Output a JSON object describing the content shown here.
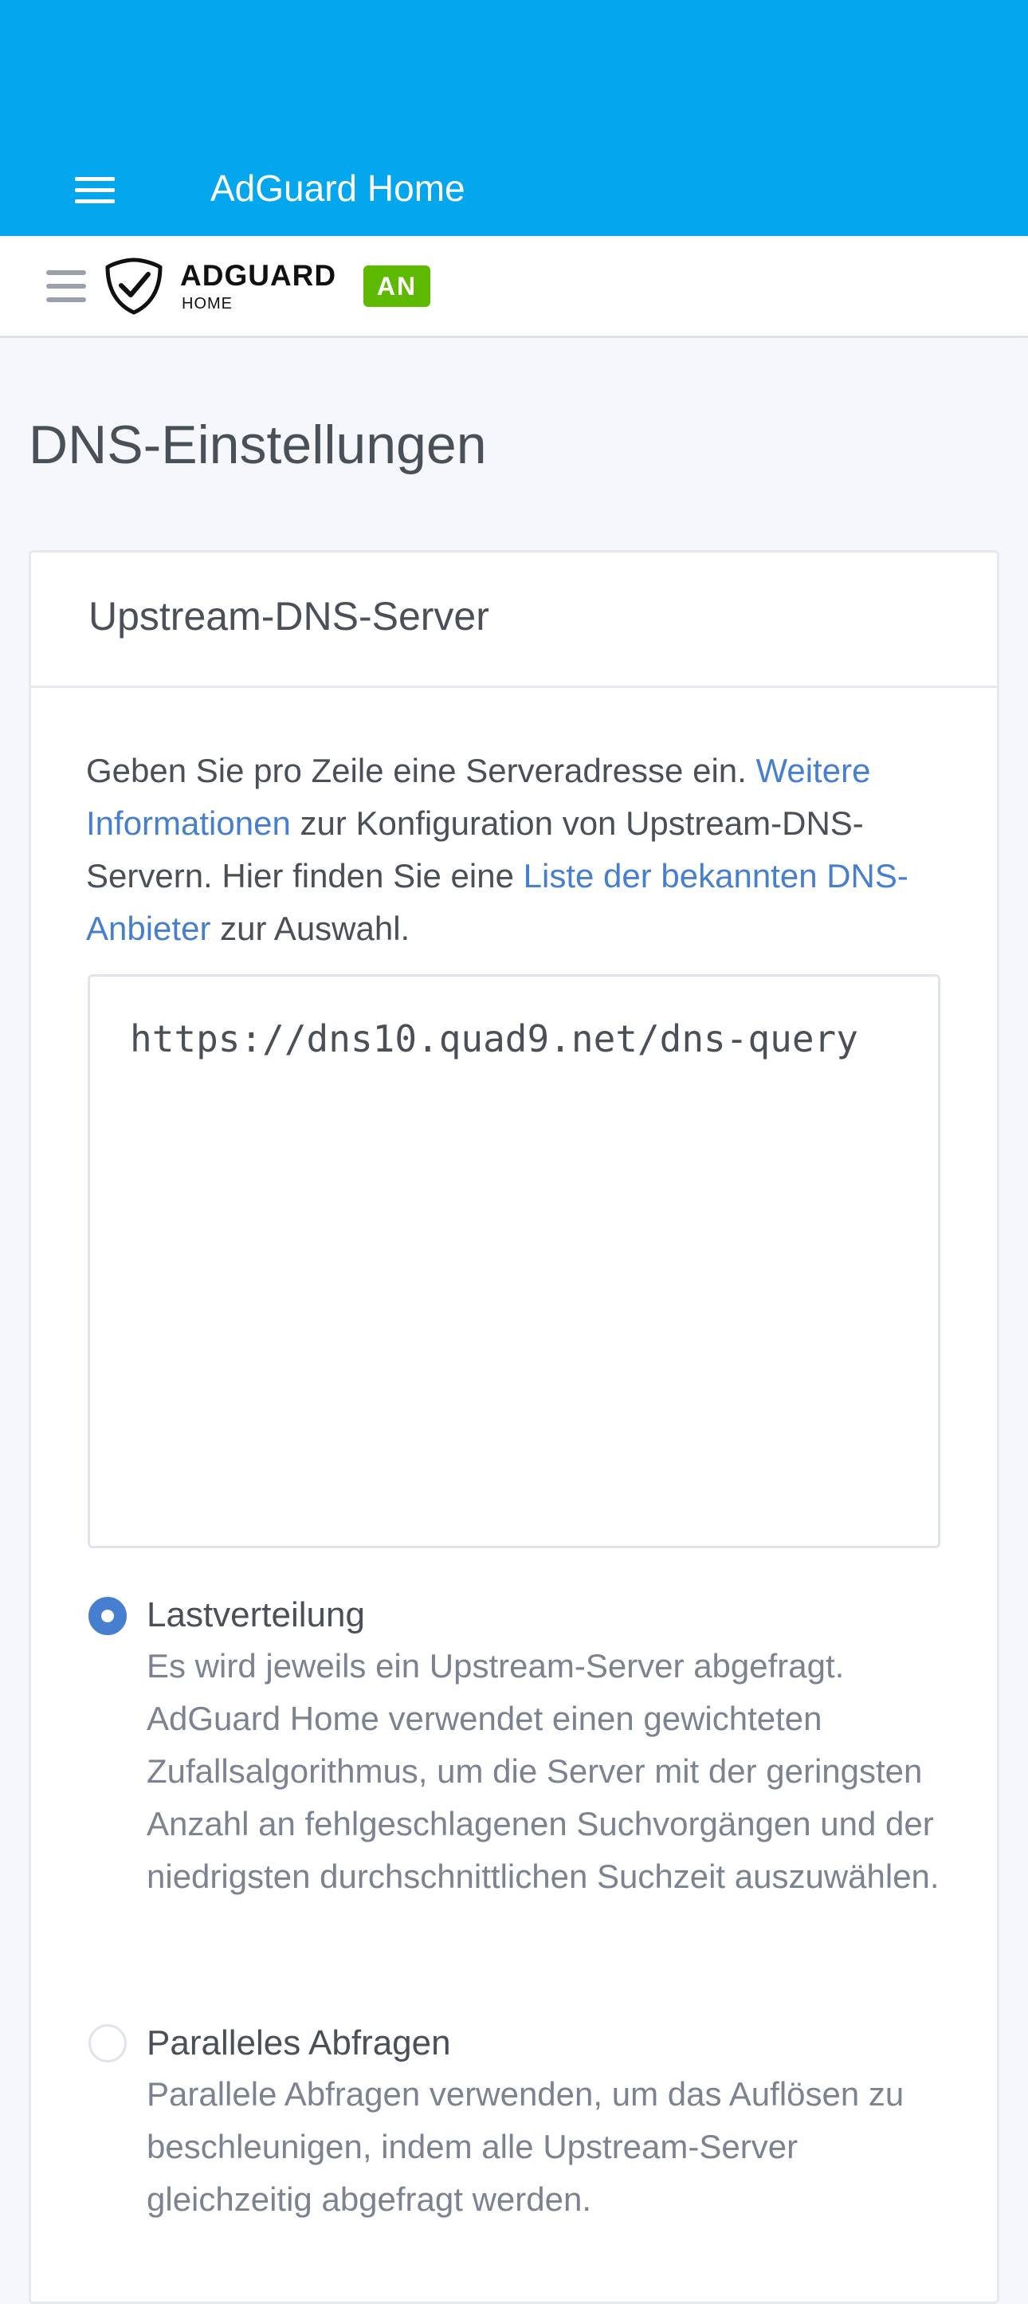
{
  "app_bar": {
    "title": "AdGuard Home"
  },
  "header": {
    "logo_text": "ADGUARD",
    "logo_subtext": "HOME",
    "status_badge": "AN"
  },
  "page": {
    "title": "DNS-Einstellungen"
  },
  "upstream_card": {
    "title": "Upstream-DNS-Server",
    "description": {
      "text_1": "Geben Sie pro Zeile eine Serveradresse ein. ",
      "link_1": "Weitere Informationen",
      "text_2": " zur Konfiguration von Upstream-DNS-Servern. Hier finden Sie eine ",
      "link_2": "Liste der bekannten DNS-Anbieter",
      "text_3": " zur Auswahl."
    },
    "upstream_value": "https://dns10.quad9.net/dns-query",
    "modes": [
      {
        "label": "Lastverteilung",
        "description": "Es wird jeweils ein Upstream-Server abgefragt. AdGuard Home verwendet einen gewichteten Zufallsalgorithmus, um die Server mit der geringsten Anzahl an fehlgeschlagenen Suchvorgängen und der niedrigsten durchschnittlichen Suchzeit auszuwählen.",
        "selected": true
      },
      {
        "label": "Paralleles Abfragen",
        "description": "Parallele Abfragen verwenden, um das Auflösen zu beschleunigen, indem alle Upstream-Server gleichzeitig abgefragt werden.",
        "selected": false
      }
    ]
  },
  "colors": {
    "app_bar": "#04a6ee",
    "link": "#467fcf",
    "status_on": "#5eba00",
    "page_background": "#f5f7fb"
  },
  "icons": {
    "app_menu": "hamburger-menu-icon",
    "site_menu": "hamburger-menu-icon",
    "logo": "adguard-shield-logo-icon"
  }
}
